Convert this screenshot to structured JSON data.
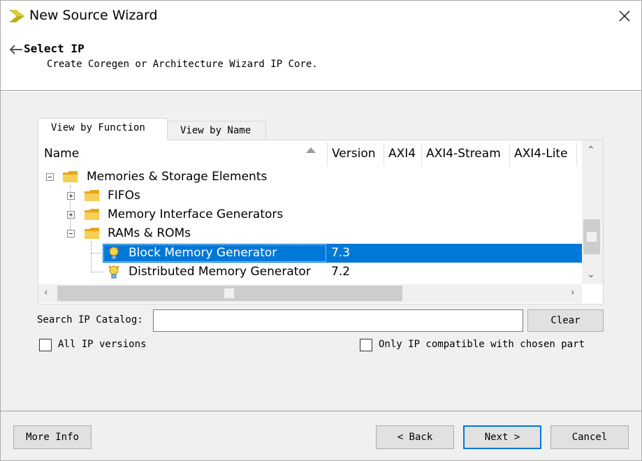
{
  "window": {
    "title": "New Source Wizard",
    "close_icon": "close-icon",
    "logo_icon": "xilinx-logo-icon"
  },
  "header": {
    "title": "Select IP",
    "subtitle": "Create Coregen or Architecture Wizard IP Core.",
    "back_icon": "back-arrow-icon"
  },
  "tabs": [
    {
      "label": "View by Function",
      "active": true
    },
    {
      "label": "View by Name",
      "active": false
    }
  ],
  "grid": {
    "columns": [
      "Name",
      "Version",
      "AXI4",
      "AXI4-Stream",
      "AXI4-Lite"
    ],
    "rows": [
      {
        "name": "Memories & Storage Elements",
        "version": "",
        "icon": "folder-icon",
        "expander": "minus"
      },
      {
        "name": "FIFOs",
        "version": "",
        "icon": "folder-icon",
        "expander": "plus"
      },
      {
        "name": "Memory Interface Generators",
        "version": "",
        "icon": "folder-icon",
        "expander": "plus"
      },
      {
        "name": "RAMs & ROMs",
        "version": "",
        "icon": "folder-icon",
        "expander": "minus"
      },
      {
        "name": "Block Memory Generator",
        "version": "7.3",
        "icon": "ip-core-icon",
        "selected": true
      },
      {
        "name": "Distributed Memory Generator",
        "version": "7.2",
        "icon": "ip-core-icon",
        "selected": false
      }
    ]
  },
  "search": {
    "label": "Search IP Catalog:",
    "value": "",
    "clear_label": "Clear"
  },
  "options": {
    "all_versions_label": "All IP versions",
    "all_versions_checked": false,
    "compatible_label": "Only IP compatible with chosen part",
    "compatible_checked": false
  },
  "footer": {
    "more_info": "More Info",
    "back": "< Back",
    "next": "Next >",
    "cancel": "Cancel"
  },
  "colors": {
    "selection": "#0078d7",
    "folder": "#f5c542",
    "body_bg": "#f0f0f0"
  }
}
